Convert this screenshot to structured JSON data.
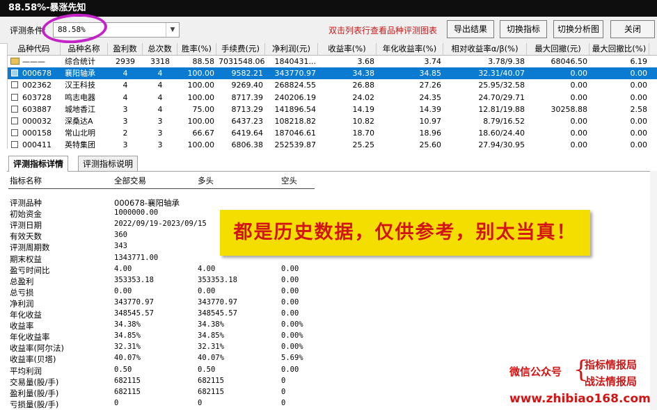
{
  "window": {
    "title": "88.58%-暴涨先知"
  },
  "toolbar": {
    "condition_label": "评测条件:",
    "condition_value": "88.58%",
    "hint": "双击列表行查看品种评测图表",
    "export_label": "导出结果",
    "switch_indicator_label": "切换指标",
    "switch_chart_label": "切换分析图",
    "close_label": "关闭"
  },
  "grid": {
    "headers": [
      "品种代码",
      "品种名称",
      "盈利数",
      "总次数",
      "胜率(%)",
      "手续费(元)",
      "净利润(元)",
      "收益率(%)",
      "年化收益率(%)",
      "相对收益率α/β(%)",
      "最大回撤(元)",
      "最大回撤比(%)"
    ],
    "rows": [
      {
        "code": "———",
        "name": "综合统计",
        "win": "2939",
        "total": "3318",
        "rate": "88.58",
        "fee": "7031548.06",
        "profit": "1840431...",
        "ret": "3.68",
        "annual": "3.74",
        "ab": "3.78/9.38",
        "dd": "68046.50",
        "ddr": "6.19"
      },
      {
        "code": "000678",
        "name": "襄阳轴承",
        "win": "4",
        "total": "4",
        "rate": "100.00",
        "fee": "9582.21",
        "profit": "343770.97",
        "ret": "34.38",
        "annual": "34.85",
        "ab": "32.31/40.07",
        "dd": "0.00",
        "ddr": "0.00"
      },
      {
        "code": "002362",
        "name": "汉王科技",
        "win": "4",
        "total": "4",
        "rate": "100.00",
        "fee": "9269.40",
        "profit": "268824.55",
        "ret": "26.88",
        "annual": "27.26",
        "ab": "25.95/32.58",
        "dd": "0.00",
        "ddr": "0.00"
      },
      {
        "code": "603728",
        "name": "鸣志电器",
        "win": "4",
        "total": "4",
        "rate": "100.00",
        "fee": "8717.39",
        "profit": "240206.19",
        "ret": "24.02",
        "annual": "24.35",
        "ab": "24.70/29.71",
        "dd": "0.00",
        "ddr": "0.00"
      },
      {
        "code": "603887",
        "name": "城地香江",
        "win": "3",
        "total": "4",
        "rate": "75.00",
        "fee": "8713.29",
        "profit": "141896.54",
        "ret": "14.19",
        "annual": "14.39",
        "ab": "12.81/19.88",
        "dd": "30258.88",
        "ddr": "2.58"
      },
      {
        "code": "000032",
        "name": "深桑达A",
        "win": "3",
        "total": "3",
        "rate": "100.00",
        "fee": "6437.23",
        "profit": "108218.82",
        "ret": "10.82",
        "annual": "10.97",
        "ab": "8.79/16.52",
        "dd": "0.00",
        "ddr": "0.00"
      },
      {
        "code": "000158",
        "name": "常山北明",
        "win": "2",
        "total": "3",
        "rate": "66.67",
        "fee": "6419.64",
        "profit": "187046.61",
        "ret": "18.70",
        "annual": "18.96",
        "ab": "18.60/24.40",
        "dd": "0.00",
        "ddr": "0.00"
      },
      {
        "code": "000411",
        "name": "英特集团",
        "win": "3",
        "total": "3",
        "rate": "100.00",
        "fee": "6806.38",
        "profit": "252539.87",
        "ret": "25.25",
        "annual": "25.60",
        "ab": "27.94/30.95",
        "dd": "0.00",
        "ddr": "0.00"
      }
    ]
  },
  "tabs": [
    "评测指标详情",
    "评测指标说明"
  ],
  "detail": {
    "headers": [
      "指标名称",
      "全部交易",
      "多头",
      "空头"
    ],
    "rows": [
      {
        "name": "评测品种",
        "all": "000678-襄阳轴承",
        "long": "",
        "short": ""
      },
      {
        "name": "初始资金",
        "all": "1000000.00",
        "long": "",
        "short": ""
      },
      {
        "name": "评测日期",
        "all": "2022/09/19-2023/09/15",
        "long": "",
        "short": ""
      },
      {
        "name": "有效天数",
        "all": "360",
        "long": "",
        "short": ""
      },
      {
        "name": "评测周期数",
        "all": "343",
        "long": "",
        "short": ""
      },
      {
        "name": "期末权益",
        "all": "1343771.00",
        "long": "",
        "short": ""
      },
      {
        "name": "盈亏时间比",
        "all": "4.00",
        "long": "4.00",
        "short": "0.00"
      },
      {
        "name": "总盈利",
        "all": "353353.18",
        "long": "353353.18",
        "short": "0.00"
      },
      {
        "name": "总亏损",
        "all": "0.00",
        "long": "0.00",
        "short": "0.00"
      },
      {
        "name": "净利润",
        "all": "343770.97",
        "long": "343770.97",
        "short": "0.00"
      },
      {
        "name": "年化收益",
        "all": "348545.57",
        "long": "348545.57",
        "short": "0.00"
      },
      {
        "name": "收益率",
        "all": "34.38%",
        "long": "34.38%",
        "short": "0.00%"
      },
      {
        "name": "年化收益率",
        "all": "34.85%",
        "long": "34.85%",
        "short": "0.00%"
      },
      {
        "name": "收益率(阿尔法)",
        "all": "32.31%",
        "long": "32.31%",
        "short": "0.00%"
      },
      {
        "name": "收益率(贝塔)",
        "all": "40.07%",
        "long": "40.07%",
        "short": "5.69%"
      },
      {
        "name": "平均利润",
        "all": "0.50",
        "long": "0.50",
        "short": "0.00"
      },
      {
        "name": "交易量(股/手)",
        "all": "682115",
        "long": "682115",
        "short": "0"
      },
      {
        "name": "盈利量(股/手)",
        "all": "682115",
        "long": "682115",
        "short": "0"
      },
      {
        "name": "亏损量(股/手)",
        "all": "0",
        "long": "0",
        "short": "0"
      }
    ]
  },
  "overlay": {
    "banner": "都是历史数据，仅供参考，别太当真！",
    "wm_label": "微信公众号",
    "wm_brace": "{",
    "wm_name1": "指标情报局",
    "wm_name2": "战法情报局",
    "wm_url": "www.zhibiao168.com"
  },
  "colors": {
    "selected_row": "#0b7ad1",
    "hint": "#c81818",
    "banner_bg": "#f3de00",
    "ring": "#c322c7"
  }
}
